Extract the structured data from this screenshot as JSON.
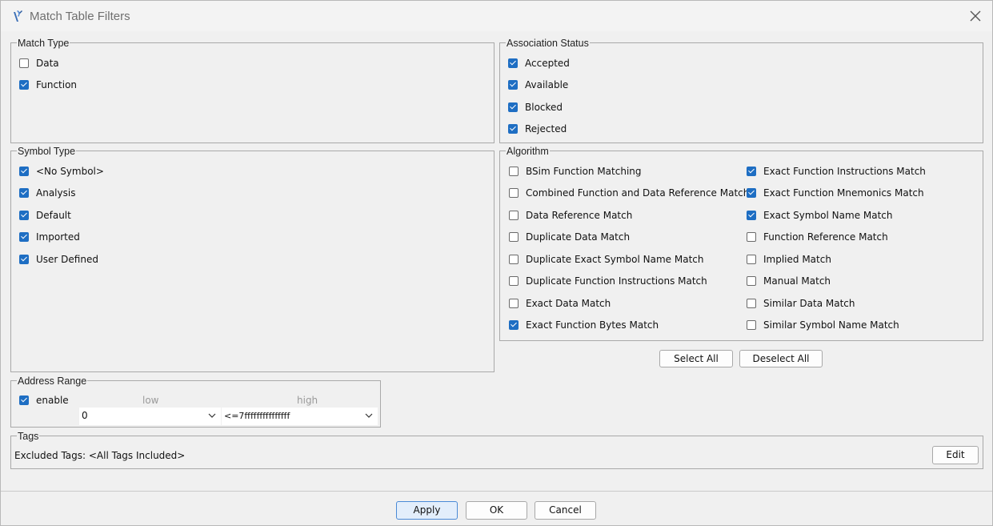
{
  "window": {
    "title": "Match Table Filters"
  },
  "match_type": {
    "legend": "Match Type",
    "items": [
      {
        "label": "Data",
        "checked": false
      },
      {
        "label": "Function",
        "checked": true
      }
    ]
  },
  "association_status": {
    "legend": "Association Status",
    "items": [
      {
        "label": "Accepted",
        "checked": true
      },
      {
        "label": "Available",
        "checked": true
      },
      {
        "label": "Blocked",
        "checked": true
      },
      {
        "label": "Rejected",
        "checked": true
      }
    ]
  },
  "symbol_type": {
    "legend": "Symbol Type",
    "items": [
      {
        "label": "<No Symbol>",
        "checked": true
      },
      {
        "label": "Analysis",
        "checked": true
      },
      {
        "label": "Default",
        "checked": true
      },
      {
        "label": "Imported",
        "checked": true
      },
      {
        "label": "User Defined",
        "checked": true
      }
    ]
  },
  "algorithm": {
    "legend": "Algorithm",
    "left": [
      {
        "label": "BSim Function Matching",
        "checked": false
      },
      {
        "label": "Combined Function and Data Reference Match",
        "checked": false
      },
      {
        "label": "Data Reference Match",
        "checked": false
      },
      {
        "label": "Duplicate Data Match",
        "checked": false
      },
      {
        "label": "Duplicate Exact Symbol Name Match",
        "checked": false
      },
      {
        "label": "Duplicate Function Instructions Match",
        "checked": false
      },
      {
        "label": "Exact Data Match",
        "checked": false
      },
      {
        "label": "Exact Function Bytes Match",
        "checked": true
      }
    ],
    "right": [
      {
        "label": "Exact Function Instructions Match",
        "checked": true
      },
      {
        "label": "Exact Function Mnemonics Match",
        "checked": true
      },
      {
        "label": "Exact Symbol Name Match",
        "checked": true
      },
      {
        "label": "Function Reference Match",
        "checked": false
      },
      {
        "label": "Implied Match",
        "checked": false
      },
      {
        "label": "Manual Match",
        "checked": false
      },
      {
        "label": "Similar Data Match",
        "checked": false
      },
      {
        "label": "Similar Symbol Name Match",
        "checked": false
      }
    ],
    "select_all_label": "Select All",
    "deselect_all_label": "Deselect All"
  },
  "address_range": {
    "legend": "Address Range",
    "enable_label": "enable",
    "enable_checked": true,
    "low_label": "low",
    "high_label": "high",
    "low_value": "0",
    "high_value": "<=7fffffffffffffff"
  },
  "tags": {
    "legend": "Tags",
    "excluded_text": "Excluded Tags: <All Tags Included>",
    "edit_label": "Edit"
  },
  "footer": {
    "apply_label": "Apply",
    "ok_label": "OK",
    "cancel_label": "Cancel"
  },
  "colors": {
    "accent": "#1e6ec3",
    "background": "#f0f0f0",
    "border": "#a9a9a9"
  }
}
